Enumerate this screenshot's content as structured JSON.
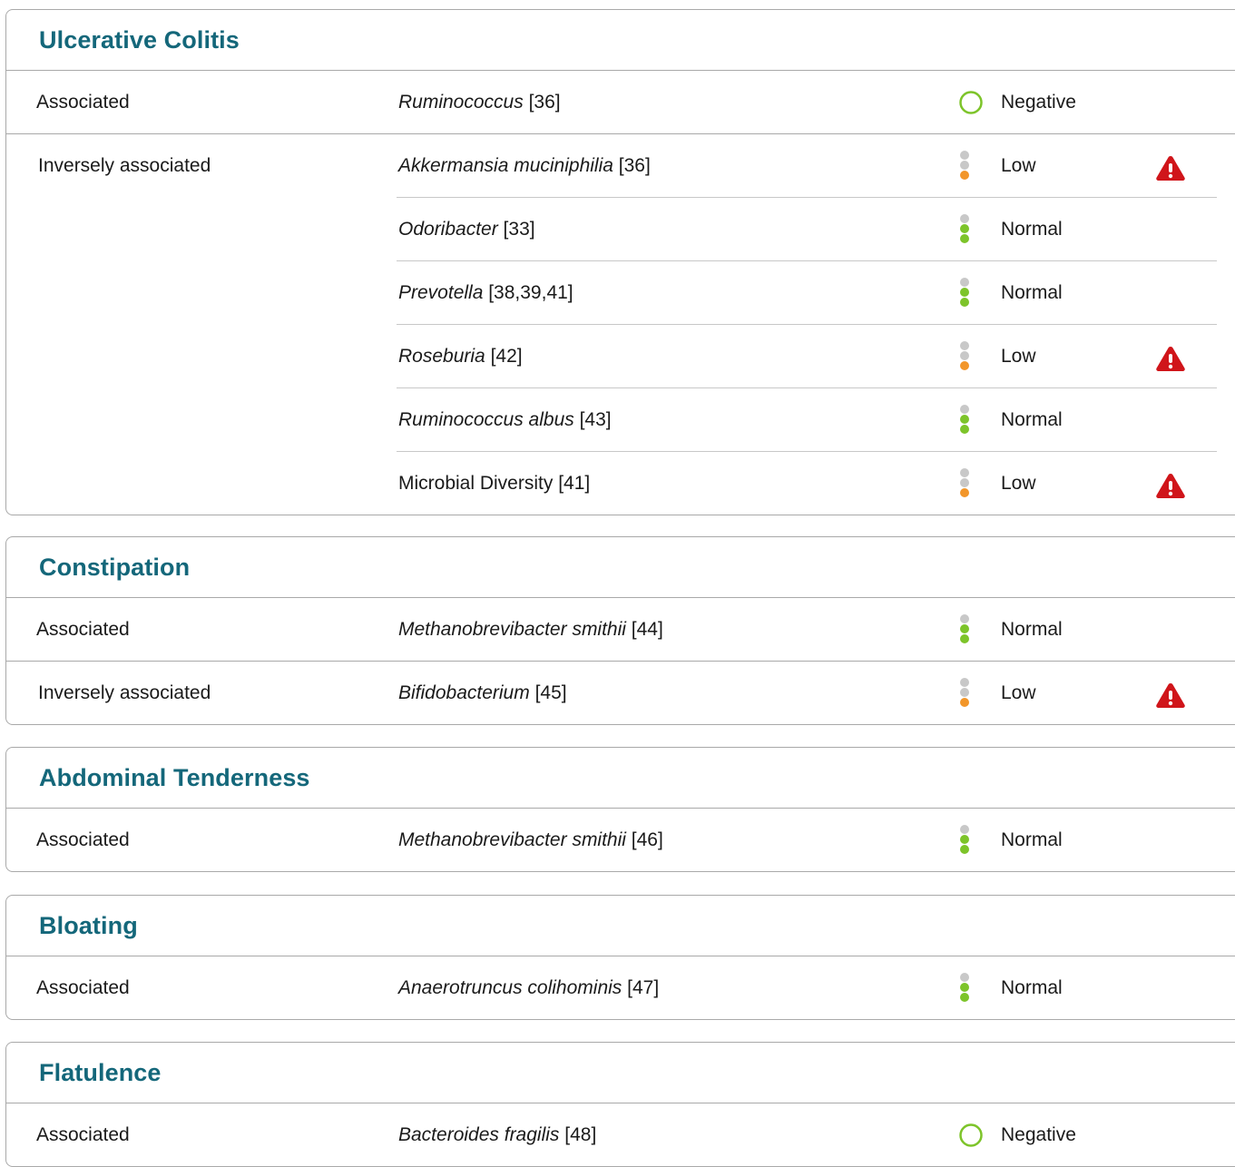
{
  "colors": {
    "title": "#14677a",
    "green": "#7dc42a",
    "orange": "#f2962a",
    "gray": "#c8c8c8",
    "alert": "#d0151a"
  },
  "sections": [
    {
      "title": "Ulcerative Colitis",
      "groups": [
        {
          "association": "Associated",
          "rows": [
            {
              "italic": "Ruminococcus",
              "ref": " [36]",
              "indicator": "negative-ring",
              "status": "Negative",
              "warning": false
            }
          ]
        },
        {
          "association": "Inversely associated",
          "rows": [
            {
              "italic": "Akkermansia muciniphilia",
              "ref": " [36]",
              "indicator": "low",
              "status": "Low",
              "warning": true
            },
            {
              "italic": "Odoribacter",
              "ref": " [33]",
              "indicator": "normal",
              "status": "Normal",
              "warning": false
            },
            {
              "italic": "Prevotella",
              "ref": " [38,39,41]",
              "indicator": "normal",
              "status": "Normal",
              "warning": false
            },
            {
              "italic": "Roseburia",
              "ref": " [42]",
              "indicator": "low",
              "status": "Low",
              "warning": true
            },
            {
              "italic": "Ruminococcus albus",
              "ref": " [43]",
              "indicator": "normal",
              "status": "Normal",
              "warning": false
            },
            {
              "italic": "",
              "ref": "Microbial Diversity [41]",
              "indicator": "low",
              "status": "Low",
              "warning": true
            }
          ]
        }
      ]
    },
    {
      "title": "Constipation",
      "groups": [
        {
          "association": "Associated",
          "rows": [
            {
              "italic": "Methanobrevibacter smithii",
              "ref": " [44]",
              "indicator": "normal",
              "status": "Normal",
              "warning": false
            }
          ]
        },
        {
          "association": "Inversely associated",
          "rows": [
            {
              "italic": "Bifidobacterium",
              "ref": " [45]",
              "indicator": "low",
              "status": "Low",
              "warning": true
            }
          ]
        }
      ]
    },
    {
      "title": "Abdominal Tenderness",
      "groups": [
        {
          "association": "Associated",
          "rows": [
            {
              "italic": "Methanobrevibacter smithii",
              "ref": " [46]",
              "indicator": "normal",
              "status": "Normal",
              "warning": false
            }
          ]
        }
      ]
    },
    {
      "title": "Bloating",
      "groups": [
        {
          "association": "Associated",
          "rows": [
            {
              "italic": "Anaerotruncus colihominis",
              "ref": " [47]",
              "indicator": "normal",
              "status": "Normal",
              "warning": false
            }
          ]
        }
      ]
    },
    {
      "title": "Flatulence",
      "groups": [
        {
          "association": "Associated",
          "rows": [
            {
              "italic": "Bacteroides fragilis",
              "ref": " [48]",
              "indicator": "negative-ring",
              "status": "Negative",
              "warning": false
            }
          ]
        }
      ]
    }
  ]
}
